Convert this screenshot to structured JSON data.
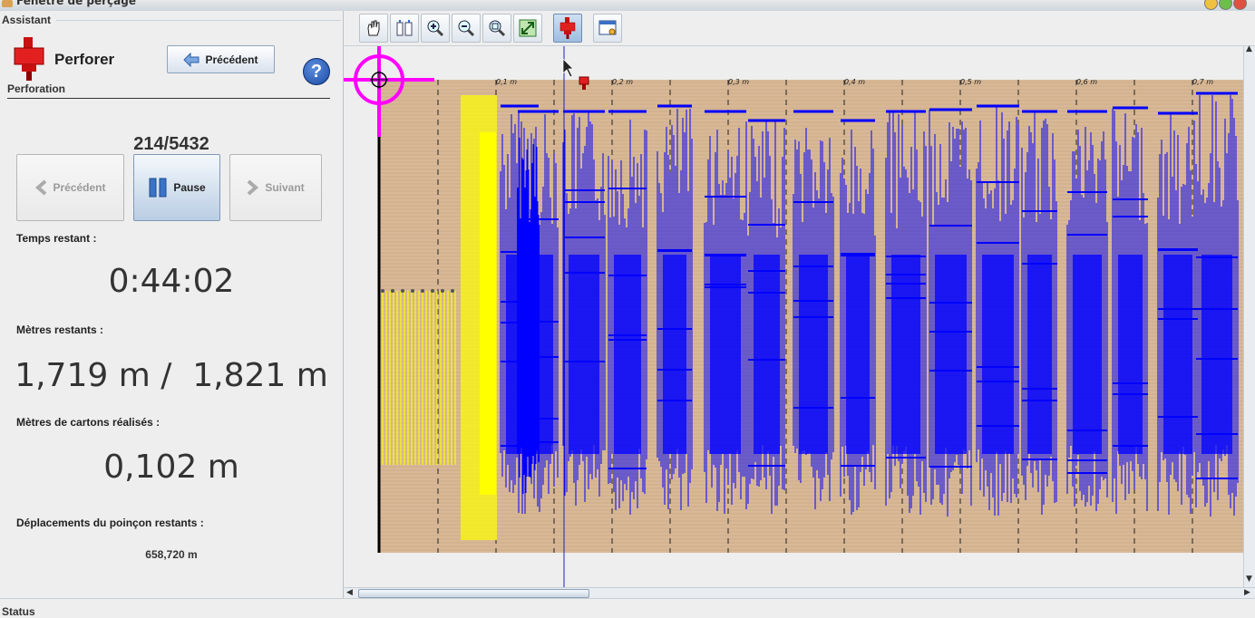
{
  "window": {
    "title": "Fenêtre de perçage"
  },
  "assistant": {
    "section_title": "Assistant",
    "step_title": "Perforer",
    "step_subtitle": "Perforation",
    "prev_top_label": "Précédent",
    "help_label": "?",
    "counter": "214/5432",
    "controls": {
      "prev_label": "Précédent",
      "pause_label": "Pause",
      "next_label": "Suivant"
    },
    "time_label": "Temps restant :",
    "time_value": "0:44:02",
    "meters_label": "Mètres restants :",
    "meters_value": "1,719 m /  1,821 m",
    "cards_label": "Mètres de cartons réalisés :",
    "cards_value": "0,102 m",
    "punch_label": "Déplacements du poinçon restants :",
    "punch_value": "658,720 m"
  },
  "toolbar": {
    "icons": [
      "hand-pan-icon",
      "fit-page-icon",
      "zoom-in-icon",
      "zoom-out-icon",
      "zoom-fit-icon",
      "fullscreen-icon",
      "punch-mode-icon",
      "window-settings-icon"
    ]
  },
  "ruler": {
    "labels": [
      "0,1 m",
      "0,2 m",
      "0,3 m",
      "0,4 m",
      "0,5 m",
      "0,6 m",
      "0,7 m"
    ]
  },
  "colors": {
    "background_strip": "#d8b896",
    "punched": "#ffff00",
    "pending": "#0000ff",
    "crosshair": "#ff00ff"
  },
  "status": {
    "label": "Status"
  }
}
